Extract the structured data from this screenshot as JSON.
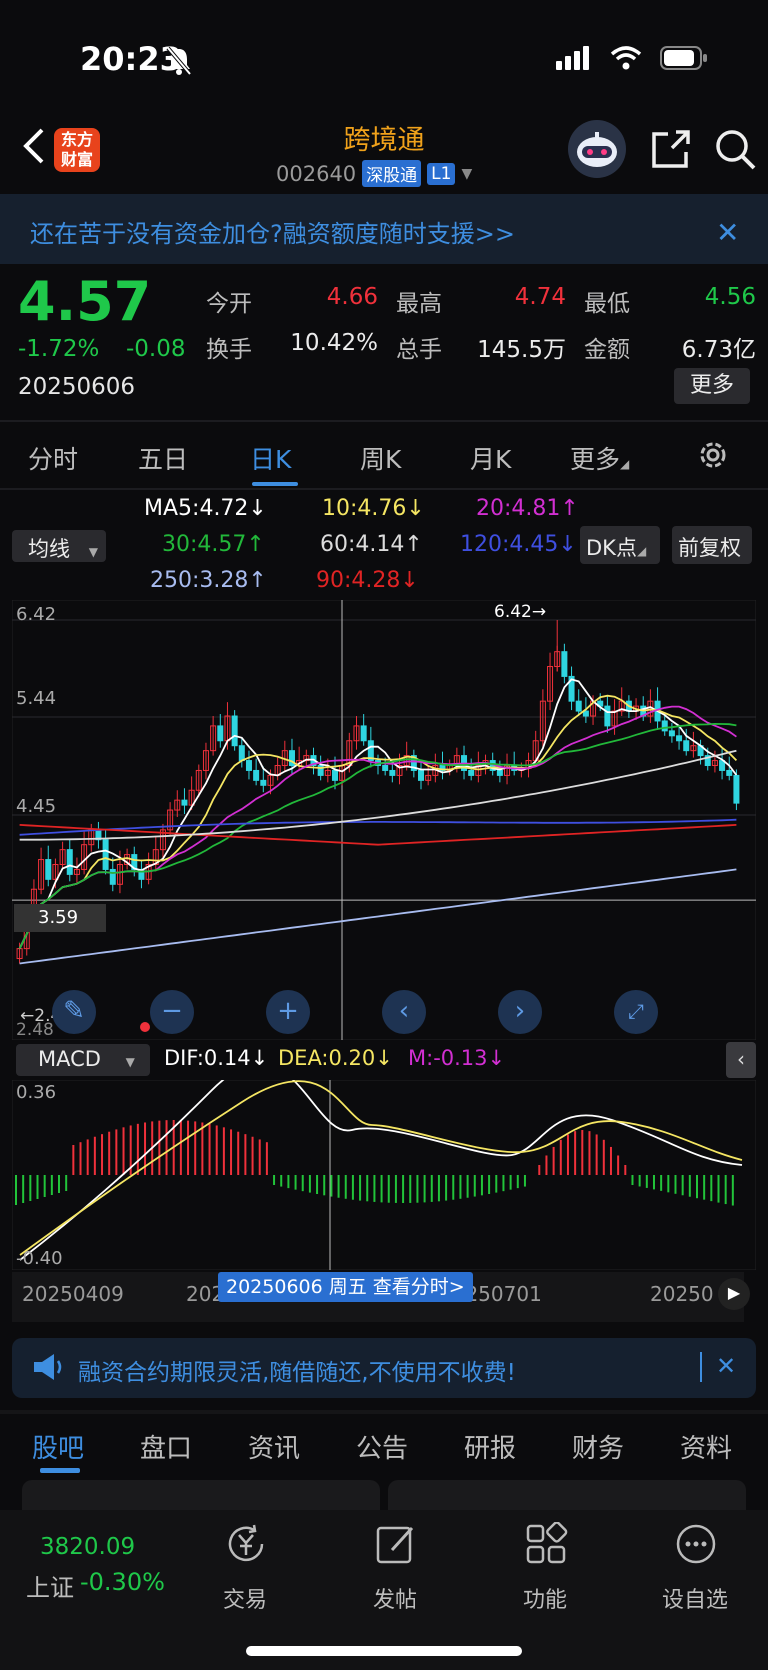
{
  "status": {
    "time": "20:23"
  },
  "nav": {
    "logo_text": "东方财富",
    "title": "跨境通",
    "code": "002640",
    "tag1": "深股通",
    "tag2": "L1"
  },
  "banner": {
    "text": "还在苦于没有资金加仓?融资额度随时支援>>"
  },
  "quote": {
    "price": "4.57",
    "pct": "-1.72%",
    "change": "-0.08",
    "date": "20250606",
    "labels": {
      "open": "今开",
      "high": "最高",
      "low": "最低",
      "turnover": "换手",
      "volume": "总手",
      "amount": "金额"
    },
    "values": {
      "open": "4.66",
      "high": "4.74",
      "low": "4.56",
      "turnover": "10.42%",
      "volume": "145.5万",
      "amount": "6.73亿"
    },
    "more": "更多"
  },
  "ktabs": [
    "分时",
    "五日",
    "日K",
    "周K",
    "月K",
    "更多"
  ],
  "ma": {
    "selector": "均线",
    "ma5": "MA5:4.72↓",
    "ma10": "10:4.76↓",
    "ma20": "20:4.81↑",
    "ma30": "30:4.57↑",
    "ma60": "60:4.14↑",
    "ma120": "120:4.45↓",
    "ma250": "250:3.28↑",
    "ma90": "90:4.28↓",
    "dk": "DK点",
    "fq": "前复权",
    "colors": {
      "ma5": "#ffffff",
      "ma10": "#f5e663",
      "ma20": "#d22fd2",
      "ma30": "#22b83a",
      "ma60": "#dcdcdc",
      "ma120": "#3f4fe0",
      "ma250": "#a8bcf0",
      "ma90": "#e02424"
    }
  },
  "chart": {
    "y_labels": [
      "6.42",
      "5.44",
      "4.45"
    ],
    "max_label": "6.42",
    "min_label": "2.48",
    "bottom_label": "2.48",
    "cross_label": "3.59"
  },
  "chart_data": {
    "type": "candlestick",
    "ylim": [
      2.48,
      6.42
    ],
    "close_series": [
      3.1,
      3.4,
      3.7,
      4.0,
      3.8,
      3.95,
      4.1,
      3.85,
      3.9,
      4.15,
      4.3,
      4.2,
      3.9,
      3.75,
      3.95,
      4.05,
      3.9,
      3.8,
      3.95,
      4.1,
      4.3,
      4.5,
      4.6,
      4.55,
      4.7,
      4.9,
      5.1,
      5.35,
      5.2,
      5.45,
      5.15,
      5.0,
      4.9,
      4.8,
      4.75,
      4.85,
      4.95,
      5.1,
      4.95,
      5.0,
      5.05,
      4.95,
      4.85,
      4.9,
      4.8,
      4.95,
      5.2,
      5.35,
      5.2,
      5.0,
      4.95,
      4.9,
      4.85,
      4.95,
      5.05,
      4.9,
      4.8,
      4.85,
      4.95,
      4.9,
      4.95,
      5.05,
      4.9,
      4.85,
      4.95,
      5.0,
      4.9,
      4.85,
      4.95,
      4.9,
      4.92,
      5.0,
      5.2,
      5.6,
      5.95,
      6.1,
      5.85,
      5.6,
      5.5,
      5.45,
      5.6,
      5.55,
      5.35,
      5.5,
      5.6,
      5.5,
      5.55,
      5.45,
      5.6,
      5.4,
      5.3,
      5.25,
      5.2,
      5.1,
      5.15,
      5.05,
      4.95,
      5.0,
      4.9,
      4.85,
      4.57
    ]
  },
  "macd": {
    "selector": "MACD",
    "dif": "DIF:0.14↓",
    "dea": "DEA:0.20↓",
    "m": "M:-0.13↓",
    "top_label": "0.36",
    "bottom_label": "-0.40"
  },
  "xaxis": {
    "labels": [
      "20250409",
      "202505",
      "20250701",
      "20250"
    ],
    "tip": "20250606 周五 查看分时>"
  },
  "promo": {
    "text": "融资合约期限灵活,随借随还,不使用不收费!"
  },
  "btabs": [
    "股吧",
    "盘口",
    "资讯",
    "公告",
    "研报",
    "财务",
    "资料"
  ],
  "footer": {
    "index_value": "3820.09",
    "index_name": "上证",
    "index_change": "-0.30%",
    "items": [
      "交易",
      "发帖",
      "功能",
      "设自选"
    ]
  }
}
